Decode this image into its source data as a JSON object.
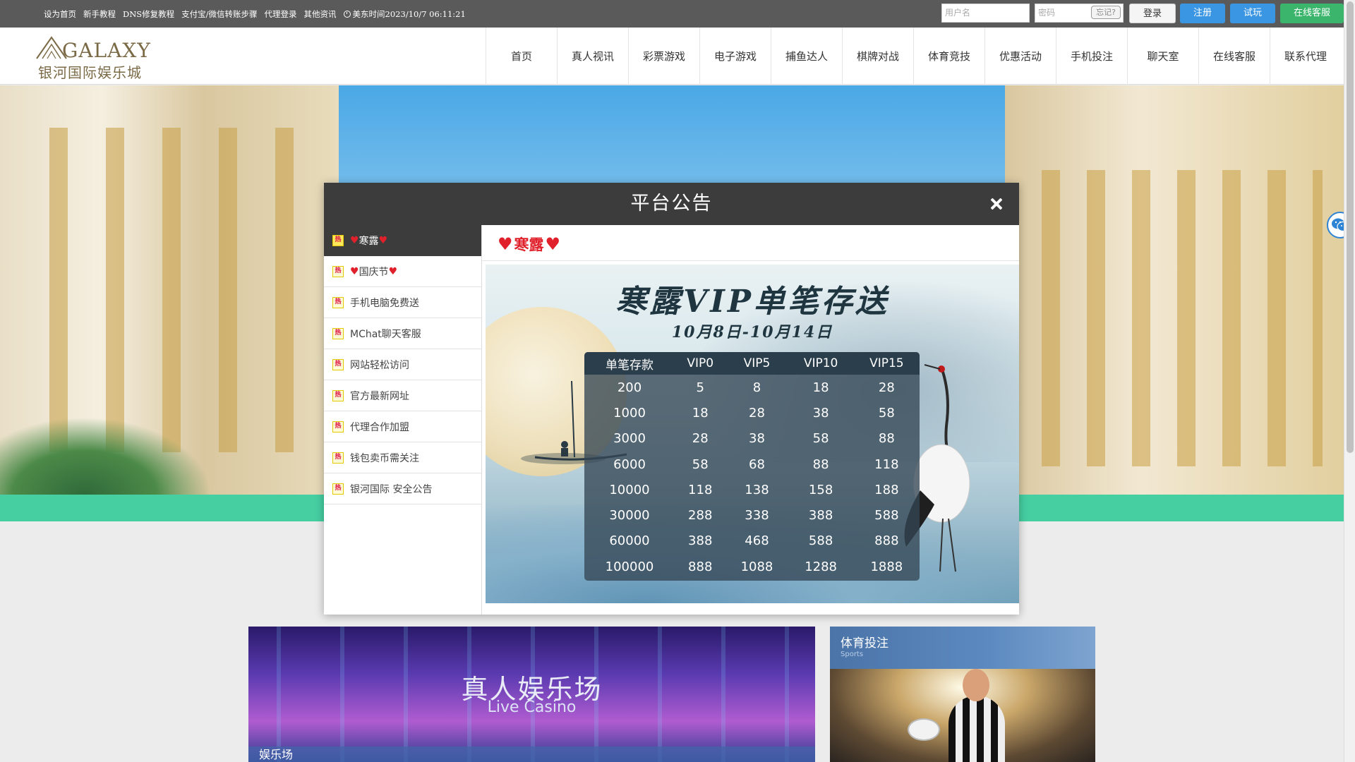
{
  "topbar": {
    "links": [
      "设为首页",
      "新手教程",
      "DNS修复教程",
      "支付宝/微信转账步骤",
      "代理登录",
      "其他资讯"
    ],
    "clock_text": "美东时间2023/10/7 06:11:21",
    "username_placeholder": "用户名",
    "password_placeholder": "密码",
    "forgot_label": "忘记?",
    "login_label": "登录",
    "register_label": "注册",
    "trial_label": "试玩",
    "service_label": "在线客服"
  },
  "logo": {
    "en": "GALAXY",
    "cn": "银河国际娱乐城"
  },
  "nav": {
    "items": [
      "首页",
      "真人视讯",
      "彩票游戏",
      "电子游戏",
      "捕鱼达人",
      "棋牌对战",
      "体育竞技",
      "优惠活动",
      "手机投注",
      "聊天室",
      "在线客服",
      "联系代理"
    ]
  },
  "cards": {
    "casino_title": "真人娱乐场",
    "casino_subtitle": "Live Casino",
    "casino_tab": "娱乐场",
    "sports_title": "体育投注",
    "sports_subtitle": "Sports"
  },
  "modal": {
    "title": "平台公告",
    "hot_badge": "热",
    "notices": [
      {
        "label": "寒露",
        "hearts": true,
        "active": true
      },
      {
        "label": "国庆节",
        "hearts": true,
        "active": false
      },
      {
        "label": "手机电脑免费送",
        "hearts": false,
        "active": false
      },
      {
        "label": "MChat聊天客服",
        "hearts": false,
        "active": false
      },
      {
        "label": "网站轻松访问",
        "hearts": false,
        "active": false
      },
      {
        "label": "官方最新网址",
        "hearts": false,
        "active": false
      },
      {
        "label": "代理合作加盟",
        "hearts": false,
        "active": false
      },
      {
        "label": "钱包卖币需关注",
        "hearts": false,
        "active": false
      },
      {
        "label": "银河国际 安全公告",
        "hearts": false,
        "active": false
      }
    ],
    "content_title": "寒露",
    "poster": {
      "title": "寒露VIP单笔存送",
      "date": "10月8日-10月14日",
      "table": {
        "headers": [
          "单笔存款",
          "VIP0",
          "VIP5",
          "VIP10",
          "VIP15"
        ],
        "rows": [
          [
            "200",
            "5",
            "8",
            "18",
            "28"
          ],
          [
            "1000",
            "18",
            "28",
            "38",
            "58"
          ],
          [
            "3000",
            "28",
            "38",
            "58",
            "88"
          ],
          [
            "6000",
            "58",
            "68",
            "88",
            "118"
          ],
          [
            "10000",
            "118",
            "138",
            "158",
            "188"
          ],
          [
            "30000",
            "288",
            "338",
            "388",
            "588"
          ],
          [
            "60000",
            "388",
            "468",
            "588",
            "888"
          ],
          [
            "100000",
            "888",
            "1088",
            "1288",
            "1888"
          ]
        ]
      }
    }
  },
  "colors": {
    "topbar_bg": "#5a5a5a",
    "register_blue": "#3a96e2",
    "service_green": "#3bb56b",
    "green_strip": "#46cfa1",
    "modal_header": "#3c3c3c",
    "heart_red": "#e0202a"
  }
}
